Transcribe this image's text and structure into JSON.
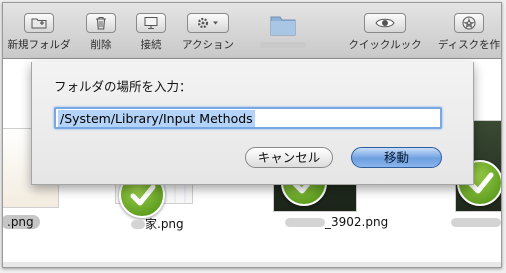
{
  "toolbar": {
    "items": [
      {
        "label": "新規フォルダ",
        "icon": "new-folder-icon"
      },
      {
        "label": "削除",
        "icon": "trash-icon"
      },
      {
        "label": "接続",
        "icon": "connect-icon"
      },
      {
        "label": "アクション",
        "icon": "gear-icon"
      },
      {
        "label": "",
        "icon": "folder-icon"
      },
      {
        "label": "クイックルック",
        "icon": "eye-icon"
      },
      {
        "label": "ディスクを作",
        "icon": "burn-disc-icon"
      }
    ]
  },
  "files": [
    {
      "name": ".png",
      "selected": true
    },
    {
      "name": "家.png",
      "selected": false
    },
    {
      "name": "_3902.png",
      "selected": false
    },
    {
      "name": "",
      "selected": false
    }
  ],
  "dialog": {
    "prompt": "フォルダの場所を入力：",
    "path_value": "/System/Library/Input Methods",
    "cancel_label": "キャンセル",
    "move_label": "移動"
  },
  "colors": {
    "accent_blue": "#6d9fe0",
    "selection": "#b3d3f8",
    "check_green": "#4a8d12"
  }
}
